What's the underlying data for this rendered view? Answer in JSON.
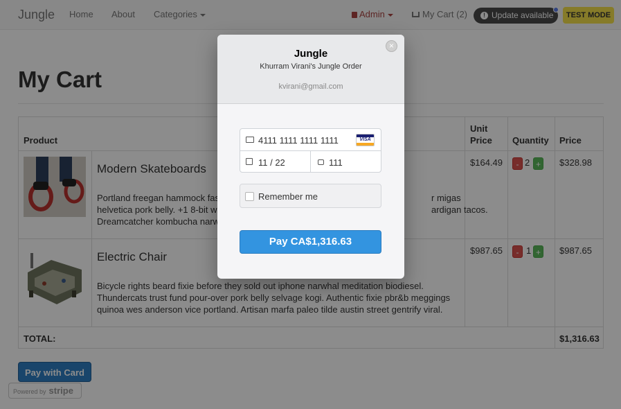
{
  "navbar": {
    "brand": "Jungle",
    "links": [
      "Home",
      "About",
      "Categories"
    ],
    "admin": "Admin",
    "cart": "My Cart (2)",
    "update": "Update available",
    "test_mode": "TEST MODE"
  },
  "page": {
    "title": "My Cart"
  },
  "table": {
    "headers": {
      "product": "Product",
      "unit_price_1": "Unit",
      "unit_price_2": "Price",
      "quantity": "Quantity",
      "price": "Price"
    },
    "rows": [
      {
        "name": "Modern Skateboards",
        "description": [
          "Portland freegan hammock fash",
          "r migas",
          "helvetica pork belly. +1 8-bit wo",
          "ardigan tacos.",
          "Dreamcatcher kombucha narw"
        ],
        "unit_price": "$164.49",
        "quantity": "2",
        "price": "$328.98"
      },
      {
        "name": "Electric Chair",
        "description": [
          "Bicycle rights beard fixie before they sold out iphone narwhal meditation biodiesel.",
          "Thundercats trust fund pour-over pork belly selvage kogi. Authentic fixie pbr&b meggings",
          "quinoa wes anderson vice portland. Artisan marfa paleo tilde austin street gentrify viral."
        ],
        "unit_price": "$987.65",
        "quantity": "1",
        "price": "$987.65"
      }
    ],
    "total_label": "TOTAL:",
    "total": "$1,316.63",
    "minus": "-",
    "plus": "+"
  },
  "pay_with_card": "Pay with Card",
  "stripe_badge": {
    "powered": "Powered by",
    "brand": "stripe"
  },
  "checkout": {
    "title": "Jungle",
    "subtitle": "Khurram Virani's Jungle Order",
    "email": "kvirani@gmail.com",
    "close": "×",
    "card_number": "4111 1111 1111 1111",
    "card_brand": "VISA",
    "expiry": "11 / 22",
    "cvc": "111",
    "remember": "Remember me",
    "pay": "Pay CA$1,316.63"
  }
}
